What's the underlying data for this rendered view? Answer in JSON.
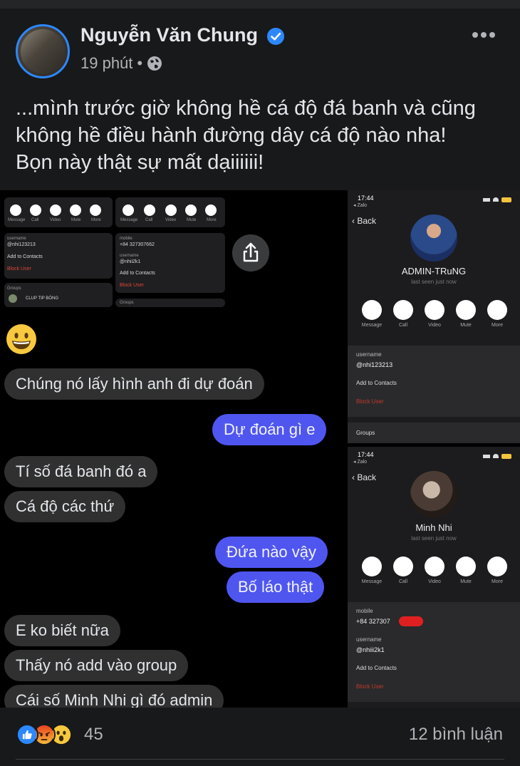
{
  "post": {
    "author": "Nguyễn Văn Chung",
    "time": "19 phút",
    "separator": "•",
    "text_lines": [
      "...mình trước giờ không hề cá độ đá banh và cũng",
      "không hề điều hành đường dây cá độ nào nha!",
      "Bọn này thật sự mất dạiiiiii!"
    ]
  },
  "chat": {
    "mini_left": {
      "actions": [
        "Message",
        "Call",
        "Video",
        "Mute",
        "More"
      ],
      "username_label": "username",
      "username": "@nhi123213",
      "add_contacts": "Add to Contacts",
      "block_user": "Block User",
      "groups_label": "Groups",
      "group_name": "CLUP TIP BÓNG"
    },
    "mini_right": {
      "actions": [
        "Message",
        "Call",
        "Video",
        "Mute",
        "More"
      ],
      "mobile_label": "mobile",
      "mobile": "+84 327307662",
      "username_label": "username",
      "username": "@nhii2k1",
      "add_contacts": "Add to Contacts",
      "block_user": "Block User",
      "groups_label": "Groups"
    },
    "messages": [
      {
        "dir": "in",
        "text": "Chúng nó lấy hình anh đi dự đoán"
      },
      {
        "dir": "out",
        "text": "Dự đoán gì e"
      },
      {
        "dir": "in",
        "text": "Tí số đá banh đó a"
      },
      {
        "dir": "in",
        "text": "Cá độ các thứ"
      },
      {
        "dir": "out",
        "text": "Đứa nào vậy"
      },
      {
        "dir": "out",
        "text": "Bố láo thật"
      },
      {
        "dir": "in",
        "text": "E ko biết nữa"
      },
      {
        "dir": "in",
        "text": "Thấy nó add vào group"
      },
      {
        "dir": "in",
        "text": "Cái số Minh Nhi gì đó admin"
      }
    ]
  },
  "profile1": {
    "time": "17:44",
    "app": "◂ Zalo",
    "back": "Back",
    "name": "ADMIN-TRuNG",
    "last_seen": "last seen just now",
    "actions": [
      "Message",
      "Call",
      "Video",
      "Mute",
      "More"
    ],
    "username_label": "username",
    "username": "@nhi123213",
    "add_contacts": "Add to Contacts",
    "block_user": "Block User",
    "groups_label": "Groups"
  },
  "profile2": {
    "time": "17:44",
    "app": "◂ Zalo",
    "back": "Back",
    "name": "Minh Nhi",
    "last_seen": "last seen just now",
    "actions": [
      "Message",
      "Call",
      "Video",
      "Mute",
      "More"
    ],
    "mobile_label": "mobile",
    "mobile": "+84 327307",
    "username_label": "username",
    "username": "@nhiii2k1",
    "add_contacts": "Add to Contacts",
    "block_user": "Block User"
  },
  "footer": {
    "reaction_count": "45",
    "comments": "12 bình luận"
  },
  "colors": {
    "background": "#18191a",
    "accent": "#2d88ff",
    "outgoing_bubble": "#4f56f0",
    "incoming_bubble": "#303030"
  },
  "icons": [
    "verified-badge-icon",
    "globe-icon",
    "more-icon",
    "share-icon",
    "grinning-emoji-icon",
    "like-reaction-icon",
    "angry-reaction-icon",
    "wow-reaction-icon"
  ]
}
